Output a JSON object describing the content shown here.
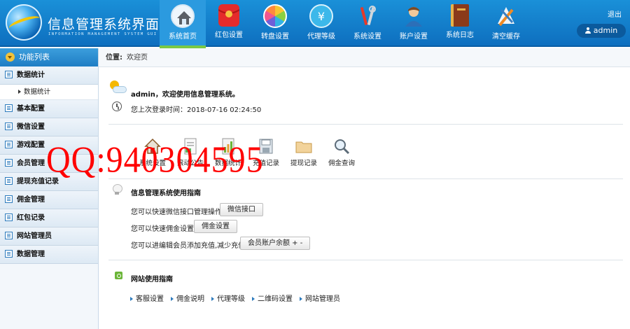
{
  "header": {
    "title": "信息管理系统界面",
    "subtitle": "INFORMATION MANAGEMENT SYSTEM GUI",
    "logout_label": "退出",
    "user_label": "admin",
    "nav": [
      {
        "label": "系统首页",
        "icon": "home-icon",
        "active": true
      },
      {
        "label": "红包设置",
        "icon": "red-envelope-icon"
      },
      {
        "label": "转盘设置",
        "icon": "wheel-icon"
      },
      {
        "label": "代理等级",
        "icon": "cloud-money-icon"
      },
      {
        "label": "系统设置",
        "icon": "tools-icon"
      },
      {
        "label": "账户设置",
        "icon": "account-icon"
      },
      {
        "label": "系统日志",
        "icon": "log-book-icon"
      },
      {
        "label": "清空缓存",
        "icon": "clear-cache-icon"
      }
    ]
  },
  "sidebar": {
    "heading": "功能列表",
    "items": [
      {
        "label": "数据统计"
      },
      {
        "label": "基本配置"
      },
      {
        "label": "微信设置"
      },
      {
        "label": "游戏配置"
      },
      {
        "label": "会员管理"
      },
      {
        "label": "提现充值记录"
      },
      {
        "label": "佣金管理"
      },
      {
        "label": "红包记录"
      },
      {
        "label": "网站管理员"
      },
      {
        "label": "数据管理"
      }
    ],
    "sub_item": "数据统计"
  },
  "main": {
    "crumb_label": "位置:",
    "crumb_value": "欢迎页",
    "welcome": "admin，欢迎使用信息管理系统。",
    "last_login": "您上次登录时间：2018-07-16 02:24:50",
    "shortcuts": [
      {
        "label": "系统设置",
        "icon": "house-icon"
      },
      {
        "label": "滚动公告",
        "icon": "document-icon"
      },
      {
        "label": "数据统计",
        "icon": "chart-icon"
      },
      {
        "label": "充值记录",
        "icon": "disk-icon"
      },
      {
        "label": "提现记录",
        "icon": "folder-icon"
      },
      {
        "label": "佣金查询",
        "icon": "magnifier-icon"
      }
    ],
    "guide_title": "信息管理系统使用指南",
    "guide_rows": [
      {
        "text": "您可以快速微信接口管理操作",
        "button": "微信接口"
      },
      {
        "text": "您可以快速佣金设置",
        "button": "佣金设置"
      },
      {
        "text": "您可以进编辑会员添加充值,减少充值",
        "button": "会员账户余额 + -"
      }
    ],
    "site_title": "网站使用指南",
    "site_links": [
      "客服设置",
      "佣金说明",
      "代理等级",
      "二维码设置",
      "网站管理员"
    ]
  },
  "watermark": "QQ:940304595",
  "colors": {
    "header": "#1a90d8",
    "active_tab": "#2b9adf",
    "active_underline": "#7ac943",
    "watermark": "#ff0000"
  }
}
